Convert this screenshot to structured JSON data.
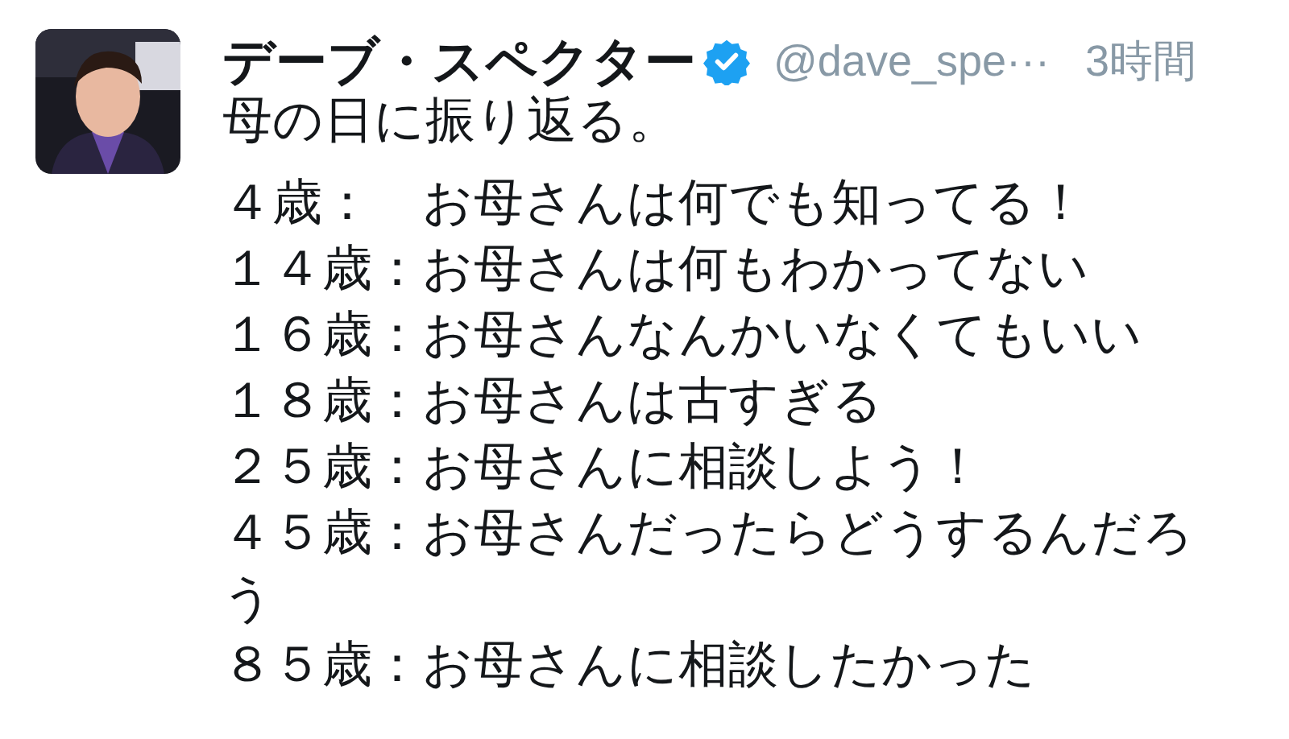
{
  "tweet": {
    "author_name": "デーブ・スペクター",
    "verified": true,
    "handle": "@dave_spe···",
    "time": "3時間",
    "intro": "母の日に振り返る。",
    "lines": [
      "４歳：　お母さんは何でも知ってる！",
      "１４歳：お母さんは何もわかってない",
      "１６歳：お母さんなんかいなくてもいい",
      "１８歳：お母さんは古すぎる",
      "２５歳：お母さんに相談しよう！",
      "４５歳：お母さんだったらどうするんだろう",
      "８５歳：お母さんに相談したかった"
    ]
  }
}
